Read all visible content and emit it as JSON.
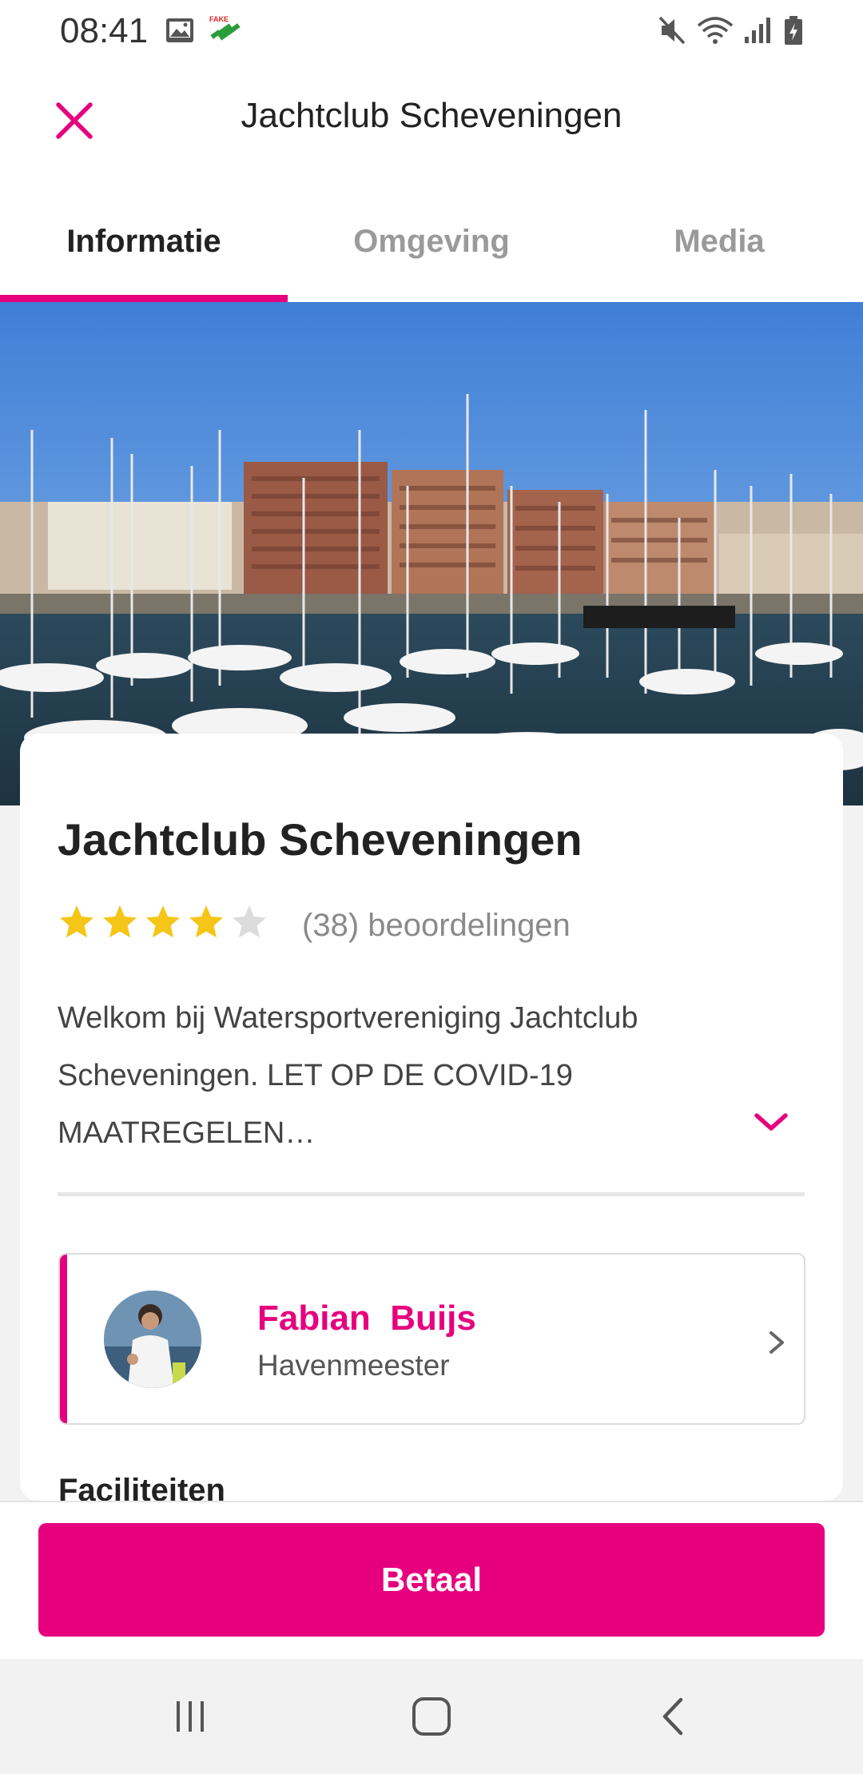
{
  "status_bar": {
    "time": "08:41",
    "icons": [
      "image-icon",
      "fake-gps-icon",
      "mute-icon",
      "wifi-icon",
      "signal-icon",
      "battery-icon"
    ]
  },
  "header": {
    "title": "Jachtclub Scheveningen",
    "close_icon": "close-icon"
  },
  "tabs": [
    {
      "label": "Informatie",
      "active": true
    },
    {
      "label": "Omgeving",
      "active": false
    },
    {
      "label": "Media",
      "active": false
    }
  ],
  "hero": {
    "alt": "marina-photo"
  },
  "details": {
    "name": "Jachtclub Scheveningen",
    "rating": 4,
    "rating_max": 5,
    "reviews_text": "(38) beoordelingen",
    "description": "Welkom bij Watersportvereniging Jachtclub Scheveningen. LET OP DE COVID-19 MAATREGELEN…",
    "expand_icon": "chevron-down-icon"
  },
  "contact": {
    "name": "Fabian  Buijs",
    "role": "Havenmeester"
  },
  "facilities_title": "Faciliteiten",
  "pay_button": "Betaal",
  "colors": {
    "accent": "#e6007e",
    "star": "#f5c518",
    "star_empty": "#dcdcdc"
  }
}
